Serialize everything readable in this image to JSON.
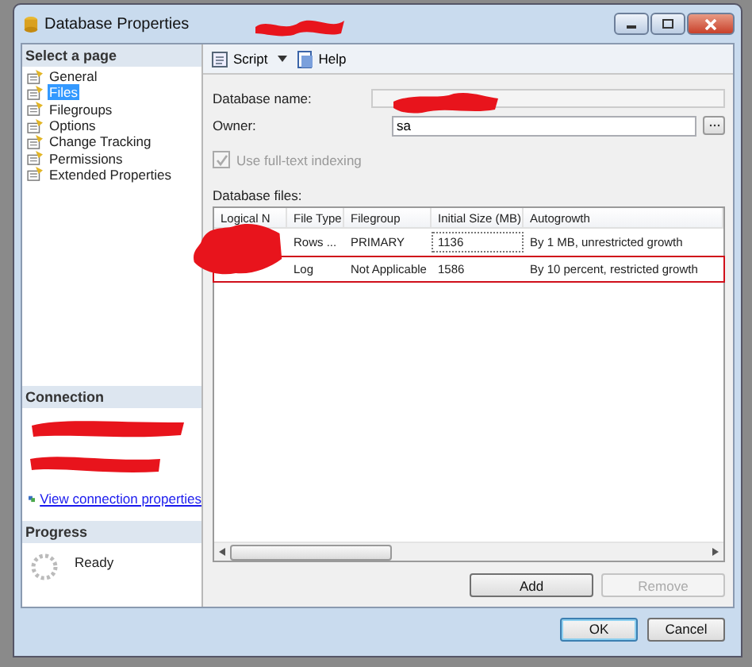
{
  "window": {
    "title": "Database Properties"
  },
  "sidebar": {
    "header": "Select a page",
    "items": [
      {
        "label": "General",
        "selected": false
      },
      {
        "label": "Files",
        "selected": true
      },
      {
        "label": "Filegroups",
        "selected": false
      },
      {
        "label": "Options",
        "selected": false
      },
      {
        "label": "Change Tracking",
        "selected": false
      },
      {
        "label": "Permissions",
        "selected": false
      },
      {
        "label": "Extended Properties",
        "selected": false
      }
    ]
  },
  "connection": {
    "header": "Connection",
    "link": "View connection properties"
  },
  "progress": {
    "header": "Progress",
    "status": "Ready"
  },
  "toolbar": {
    "script": "Script",
    "help": "Help"
  },
  "form": {
    "database_name_label": "Database name:",
    "owner_label": "Owner:",
    "owner_value": "sa",
    "fulltext": {
      "label": "Use full-text indexing",
      "checked": true,
      "disabled": true
    }
  },
  "files": {
    "label": "Database files:",
    "columns": [
      "Logical N",
      "File Type",
      "Filegroup",
      "Initial Size (MB)",
      "Autogrowth"
    ],
    "rows": [
      {
        "file_type": "Rows ...",
        "filegroup": "PRIMARY",
        "initial_size": "1136",
        "autogrowth": "By 1 MB, unrestricted growth",
        "highlighted": false
      },
      {
        "file_type": "Log",
        "filegroup": "Not Applicable",
        "initial_size": "1586",
        "autogrowth": "By 10 percent, restricted growth",
        "highlighted": true
      }
    ],
    "add": "Add",
    "remove": "Remove",
    "remove_disabled": true
  },
  "buttons": [
    "OK",
    "Cancel"
  ]
}
